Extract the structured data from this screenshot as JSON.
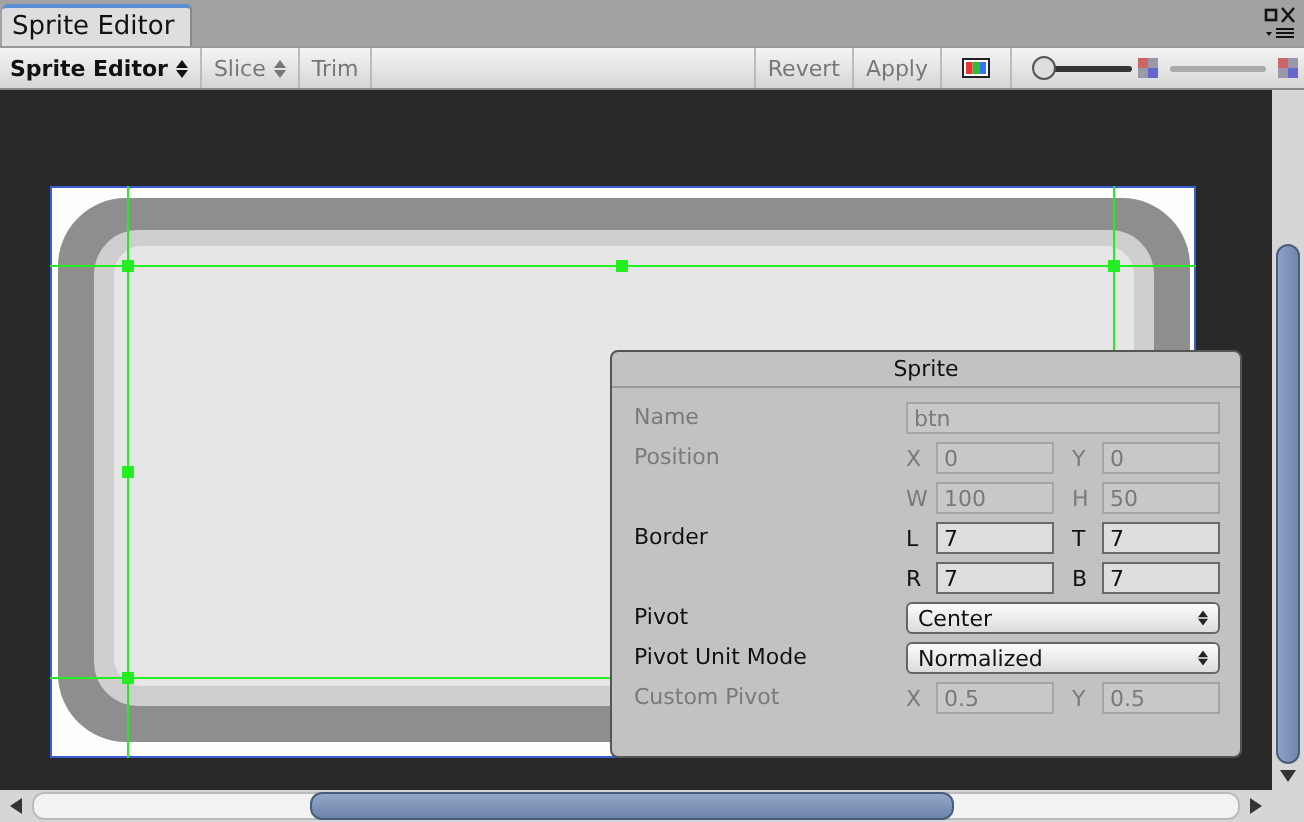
{
  "window": {
    "tab": "Sprite Editor"
  },
  "toolbar": {
    "left": [
      {
        "label": "Sprite Editor",
        "kind": "dropdown",
        "disabled": false
      },
      {
        "label": "Slice",
        "kind": "dropdown",
        "disabled": true
      },
      {
        "label": "Trim",
        "kind": "button",
        "disabled": true
      }
    ],
    "right": [
      {
        "label": "Revert",
        "disabled": true
      },
      {
        "label": "Apply",
        "disabled": true
      }
    ],
    "zoom": {
      "level": 0.05
    },
    "mip": {
      "level": 1
    }
  },
  "panel": {
    "title": "Sprite",
    "rows": [
      {
        "kind": "text",
        "label": "Name",
        "disabled": true,
        "value": "btn"
      },
      {
        "kind": "pairs",
        "label": "Position",
        "disabled": true,
        "fields": [
          {
            "axis": "X",
            "value": "0"
          },
          {
            "axis": "Y",
            "value": "0"
          },
          {
            "axis": "W",
            "value": "100"
          },
          {
            "axis": "H",
            "value": "50"
          }
        ]
      },
      {
        "kind": "pairs",
        "label": "Border",
        "disabled": false,
        "fields": [
          {
            "axis": "L",
            "value": "7"
          },
          {
            "axis": "T",
            "value": "7"
          },
          {
            "axis": "R",
            "value": "7"
          },
          {
            "axis": "B",
            "value": "7"
          }
        ]
      },
      {
        "kind": "dropdown",
        "label": "Pivot",
        "disabled": false,
        "value": "Center"
      },
      {
        "kind": "dropdown",
        "label": "Pivot Unit Mode",
        "disabled": false,
        "value": "Normalized"
      },
      {
        "kind": "pairs",
        "label": "Custom Pivot",
        "disabled": true,
        "fields": [
          {
            "axis": "X",
            "value": "0.5"
          },
          {
            "axis": "Y",
            "value": "0.5"
          }
        ]
      }
    ]
  }
}
